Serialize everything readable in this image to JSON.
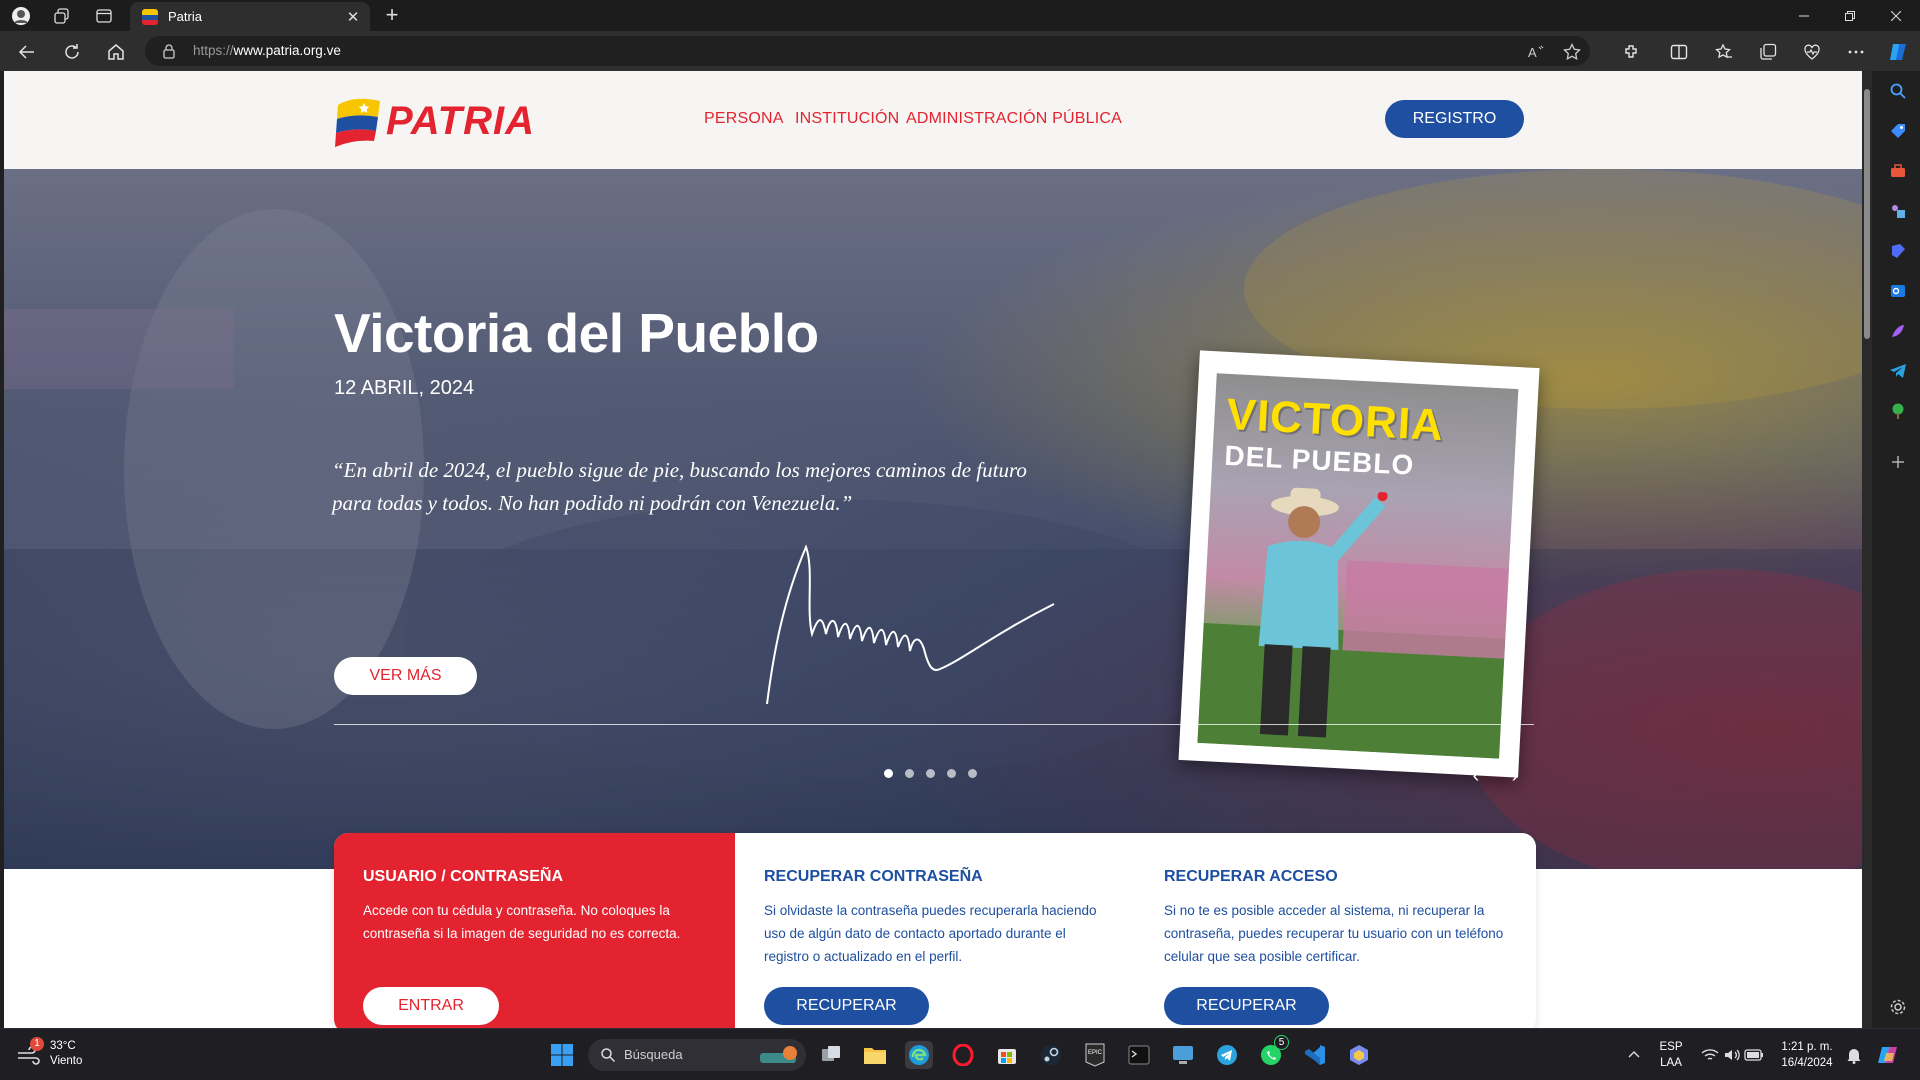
{
  "browser": {
    "tab_title": "Patria",
    "url_scheme": "https://",
    "url_host": "www.patria.org.ve"
  },
  "site": {
    "logo_text": "PATRIA",
    "nav": [
      "PERSONA",
      "INSTITUCIÓN",
      "ADMINISTRACIÓN PÚBLICA"
    ],
    "register_label": "REGISTRO"
  },
  "hero": {
    "title": "Victoria del Pueblo",
    "date": "12 ABRIL, 2024",
    "quote": "“En abril de 2024, el pueblo sigue de pie, buscando los mejores caminos de futuro para todas y todos. No han podido ni podrán con Venezuela.”",
    "button": "VER MÁS",
    "poster_line1": "VICTORIA",
    "poster_line2": "DEL PUEBLO",
    "slide_count": 5,
    "active_slide": 1
  },
  "cards": [
    {
      "title": "USUARIO / CONTRASEÑA",
      "text": "Accede con tu cédula y contraseña. No coloques la contraseña si la imagen de seguridad no es correcta.",
      "button": "ENTRAR"
    },
    {
      "title": "RECUPERAR CONTRASEÑA",
      "text": "Si olvidaste la contraseña puedes recuperarla haciendo uso de algún dato de contacto aportado durante el registro o actualizado en el perfil.",
      "button": "RECUPERAR"
    },
    {
      "title": "RECUPERAR ACCESO",
      "text": "Si no te es posible acceder al sistema, ni recuperar la contraseña, puedes recuperar tu usuario con un teléfono celular que sea posible certificar.",
      "button": "RECUPERAR"
    }
  ],
  "taskbar": {
    "weather_temp": "33°C",
    "weather_desc": "Viento",
    "weather_badge": "1",
    "search_placeholder": "Búsqueda",
    "whatsapp_badge": "5",
    "lang_top": "ESP",
    "lang_bottom": "LAA",
    "time": "1:21 p. m.",
    "date": "16/4/2024"
  },
  "colors": {
    "brand_red": "#e32430",
    "brand_blue": "#1e4fa0"
  }
}
